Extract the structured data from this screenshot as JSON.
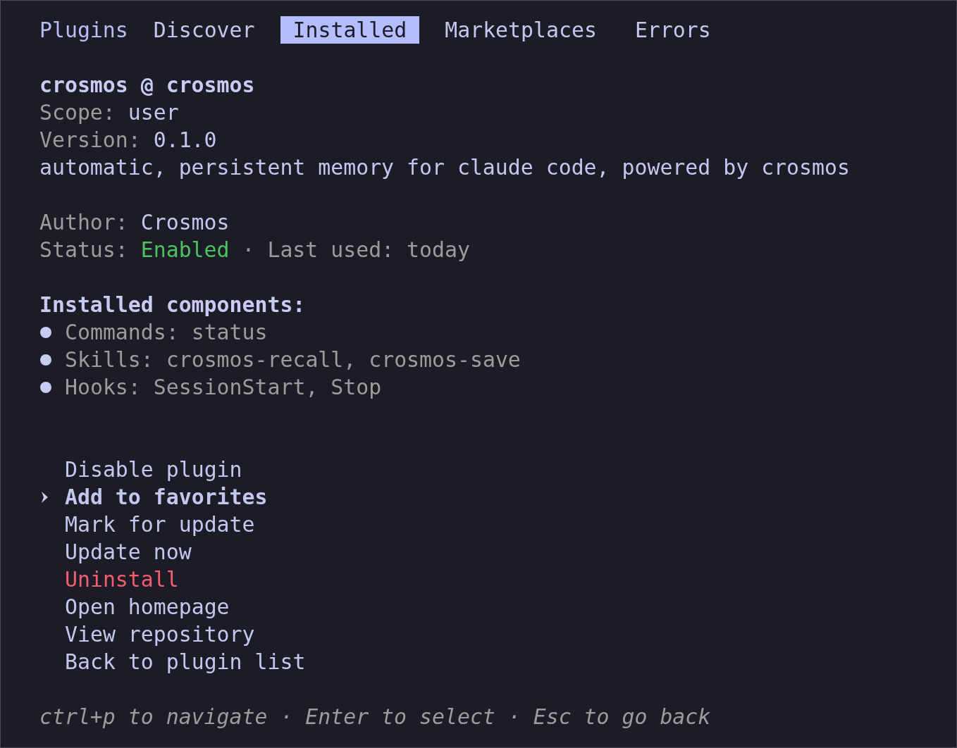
{
  "tabs": {
    "title": "Plugins",
    "items": [
      {
        "label": "Discover",
        "selected": false
      },
      {
        "label": "Installed",
        "selected": true
      },
      {
        "label": "Marketplaces",
        "selected": false
      },
      {
        "label": "Errors",
        "selected": false
      }
    ]
  },
  "plugin": {
    "title": "crosmos @ crosmos",
    "fields": [
      {
        "label": "Scope:",
        "value": "user"
      },
      {
        "label": "Version:",
        "value": "0.1.0"
      }
    ],
    "description": "automatic, persistent memory for claude code, powered by crosmos",
    "author": {
      "label": "Author:",
      "value": "Crosmos"
    },
    "status": {
      "label": "Status:",
      "value": "Enabled",
      "enabled": true,
      "last_used": "· Last used: today"
    }
  },
  "components": {
    "heading": "Installed components:",
    "items": [
      "Commands: status",
      "Skills: crosmos-recall, crosmos-save",
      "Hooks: SessionStart, Stop"
    ]
  },
  "actions": [
    {
      "label": "Disable plugin",
      "selected": false,
      "kind": "default"
    },
    {
      "label": "Add to favorites",
      "selected": true,
      "kind": "default"
    },
    {
      "label": "Mark for update",
      "selected": false,
      "kind": "default"
    },
    {
      "label": "Update now",
      "selected": false,
      "kind": "default"
    },
    {
      "label": "Uninstall",
      "selected": false,
      "kind": "danger"
    },
    {
      "label": "Open homepage",
      "selected": false,
      "kind": "default"
    },
    {
      "label": "View repository",
      "selected": false,
      "kind": "default"
    },
    {
      "label": "Back to plugin list",
      "selected": false,
      "kind": "default"
    }
  ],
  "footer": "ctrl+p to navigate · Enter to select · Esc to go back"
}
